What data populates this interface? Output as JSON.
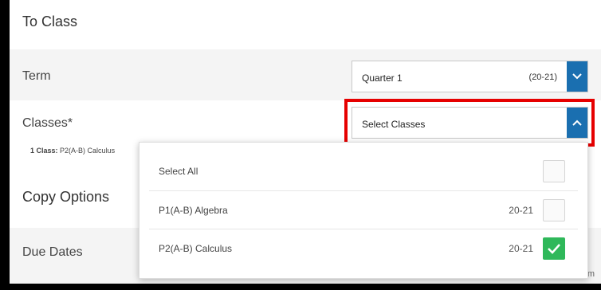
{
  "section": {
    "title": "To Class"
  },
  "term": {
    "label": "Term",
    "selected": "Quarter 1",
    "year": "(20-21)"
  },
  "classes": {
    "label": "Classes*",
    "placeholder": "Select Classes",
    "summary_count": "1 Class:",
    "summary_names": "P2(A-B) Calculus"
  },
  "copy_options": {
    "label": "Copy Options"
  },
  "due_dates": {
    "label": "Due Dates",
    "tail_text": "m"
  },
  "dropdown": {
    "select_all": "Select All",
    "options": [
      {
        "label": "P1(A-B) Algebra",
        "year": "20-21",
        "checked": false
      },
      {
        "label": "P2(A-B) Calculus",
        "year": "20-21",
        "checked": true
      }
    ]
  },
  "colors": {
    "accent_blue": "#1a6fb0",
    "highlight_red": "#e60000",
    "check_green": "#2fb85a"
  },
  "icons": {
    "term_arrow": "chevron-down-icon",
    "classes_arrow": "chevron-up-icon",
    "check": "check-icon"
  }
}
